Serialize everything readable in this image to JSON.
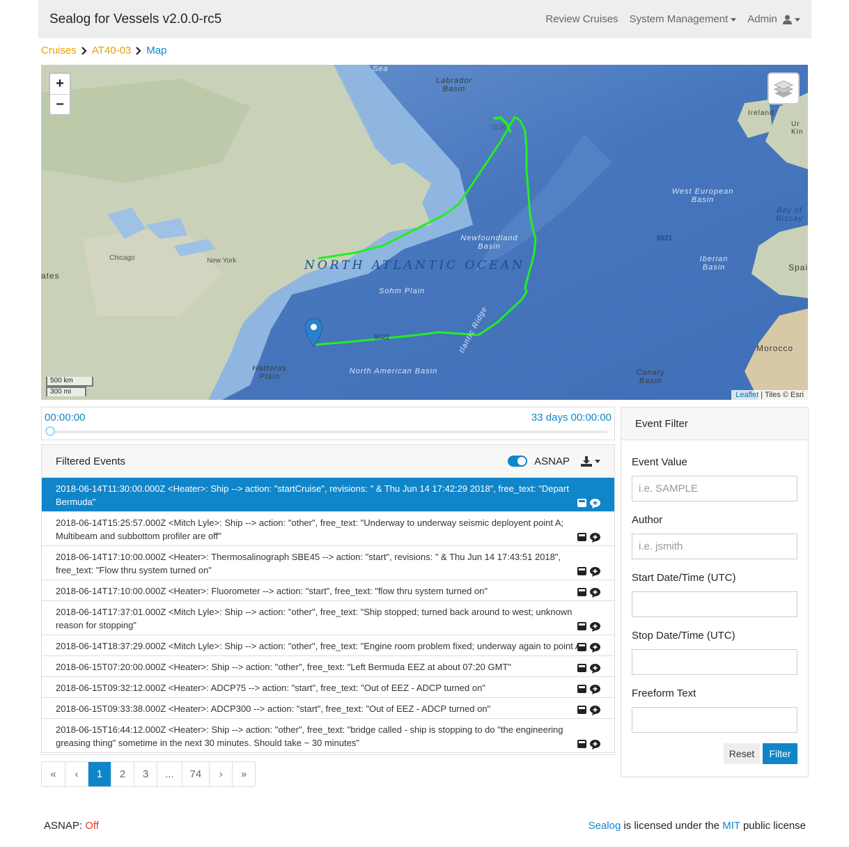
{
  "navbar": {
    "brand": "Sealog for Vessels v2.0.0-rc5",
    "review_cruises": "Review Cruises",
    "system_management": "System Management",
    "admin": "Admin"
  },
  "breadcrumb": {
    "cruises": "Cruises",
    "cruise_id": "AT40-03",
    "current": "Map"
  },
  "map": {
    "ocean_label": "NORTH ATLANTIC OCEAN",
    "labels": {
      "labrador_basin": "Labrador Basin",
      "newfoundland_basin": "Newfoundland Basin",
      "sohm_plain": "Sohm Plain",
      "west_european_basin": "West European Basin",
      "iberian_basin": "Iberian Basin",
      "north_american_basin": "North American Basin",
      "hatteras_plain": "Hatteras Plain",
      "canary_basin": "Canary Basin",
      "mid_atlantic_ridge": "tlantic Ridge",
      "bay_of_biscay": "Bay of Biscay",
      "sea": "Sea",
      "morocco": "Morocco",
      "ireland": "Ireland",
      "spain": "Spai",
      "states": "ates",
      "uk": "Ur Kin"
    },
    "cities": {
      "chicago": "Chicago",
      "new_york": "New York"
    },
    "depths": [
      "1536",
      "6521",
      "6022"
    ],
    "zoom_in": "+",
    "zoom_out": "−",
    "scale_km": "500 km",
    "scale_mi": "300 mi",
    "attribution_link": "Leaflet",
    "attribution_text": " | Tiles © Esri",
    "colors": {
      "track": "#22ee22",
      "ocean": "#4a7fc2",
      "land": "#c9d2b8"
    }
  },
  "timeline": {
    "start": "00:00:00",
    "end": "33 days 00:00:00",
    "position": 0
  },
  "events": {
    "title": "Filtered Events",
    "asnap_label": "ASNAP",
    "asnap_on": true,
    "items": [
      {
        "text": "2018-06-14T11:30:00.000Z <Heater>: Ship --> action: \"startCruise\", revisions: \" & Thu Jun 14 17:42:29 2018\", free_text: \"Depart Bermuda\"",
        "active": true
      },
      {
        "text": "2018-06-14T15:25:57.000Z <Mitch Lyle>: Ship --> action: \"other\", free_text: \"Underway to underway seismic deployent point A; Multibeam and subbottom profiler are off\""
      },
      {
        "text": "2018-06-14T17:10:00.000Z <Heater>: Thermosalinograph SBE45 --> action: \"start\", revisions: \" & Thu Jun 14 17:43:51 2018\", free_text: \"Flow thru system turned on\""
      },
      {
        "text": "2018-06-14T17:10:00.000Z <Heater>: Fluorometer --> action: \"start\", free_text: \"flow thru system turned on\""
      },
      {
        "text": "2018-06-14T17:37:01.000Z <Mitch Lyle>: Ship --> action: \"other\", free_text: \"Ship stopped; turned back around to west; unknown reason for stopping\""
      },
      {
        "text": "2018-06-14T18:37:29.000Z <Mitch Lyle>: Ship --> action: \"other\", free_text: \"Engine room problem fixed; underway again to point A\""
      },
      {
        "text": "2018-06-15T07:20:00.000Z <Heater>: Ship --> action: \"other\", free_text: \"Left Bermuda EEZ at about 07:20 GMT\""
      },
      {
        "text": "2018-06-15T09:32:12.000Z <Heater>: ADCP75 --> action: \"start\", free_text: \"Out of EEZ - ADCP turned on\""
      },
      {
        "text": "2018-06-15T09:33:38.000Z <Heater>: ADCP300 --> action: \"start\", free_text: \"Out of EEZ - ADCP turned on\""
      },
      {
        "text": "2018-06-15T16:44:12.000Z <Heater>: Ship --> action: \"other\", free_text: \"bridge called - ship is stopping to do \"the engineering greasing thing\" sometime in the next 30 minutes. Should take ~ 30 minutes\""
      }
    ]
  },
  "pagination": {
    "first": "«",
    "prev": "‹",
    "pages": [
      "1",
      "2",
      "3",
      "...",
      "74"
    ],
    "current": "1",
    "next": "›",
    "last": "»"
  },
  "filter": {
    "title": "Event Filter",
    "event_value_label": "Event Value",
    "event_value_placeholder": "i.e. SAMPLE",
    "author_label": "Author",
    "author_placeholder": "i.e. jsmith",
    "start_label": "Start Date/Time (UTC)",
    "stop_label": "Stop Date/Time (UTC)",
    "freeform_label": "Freeform Text",
    "reset": "Reset",
    "filter": "Filter"
  },
  "footer": {
    "asnap_label": "ASNAP: ",
    "asnap_value": "Off",
    "sealog": "Sealog",
    "text1": " is licensed under the ",
    "mit": "MIT",
    "text2": " public license"
  }
}
